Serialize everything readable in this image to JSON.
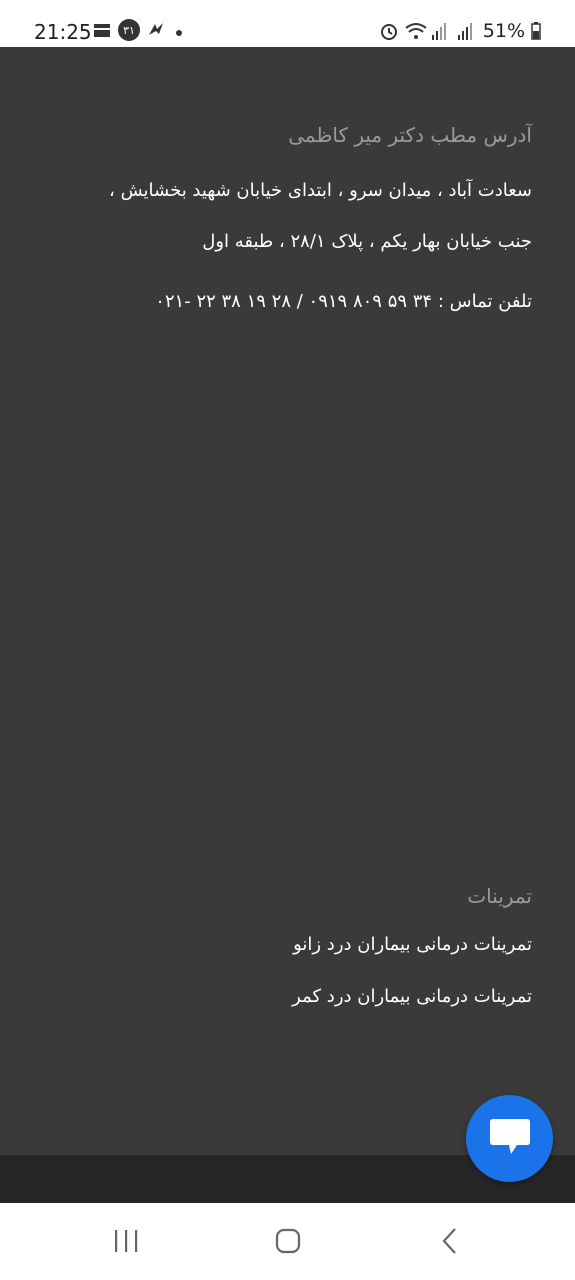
{
  "status_bar": {
    "time": "21:25",
    "left_icons": [
      "kaaba-icon",
      "calendar-badge-icon",
      "app-logo-icon"
    ],
    "notification_badge": "۳۱",
    "right_icons": [
      "alarm-icon",
      "wifi-icon",
      "signal-icon",
      "signal-icon-2"
    ],
    "battery": "51%"
  },
  "address": {
    "title": "آدرس مطب دکتر میر کاظمی",
    "line1": "سعادت آباد ، میدان سرو ، ابتدای خیابان شهید بخشایش ،",
    "line2": "جنب خیابان بهار یکم ، پلاک ۲۸/۱ ، طبقه اول",
    "phone": "تلفن تماس : ۳۴ ۵۹ ۸۰۹ ۰۹۱۹ / ۲۸ ۱۹ ۳۸ ۲۲ -۰۲۱"
  },
  "exercises": {
    "title": "تمرینات",
    "items": [
      "تمرینات درمانی بیماران درد زانو",
      "تمرینات درمانی بیماران درد کمر"
    ]
  },
  "colors": {
    "background": "#3a3a3a",
    "fab": "#1a73e8"
  }
}
